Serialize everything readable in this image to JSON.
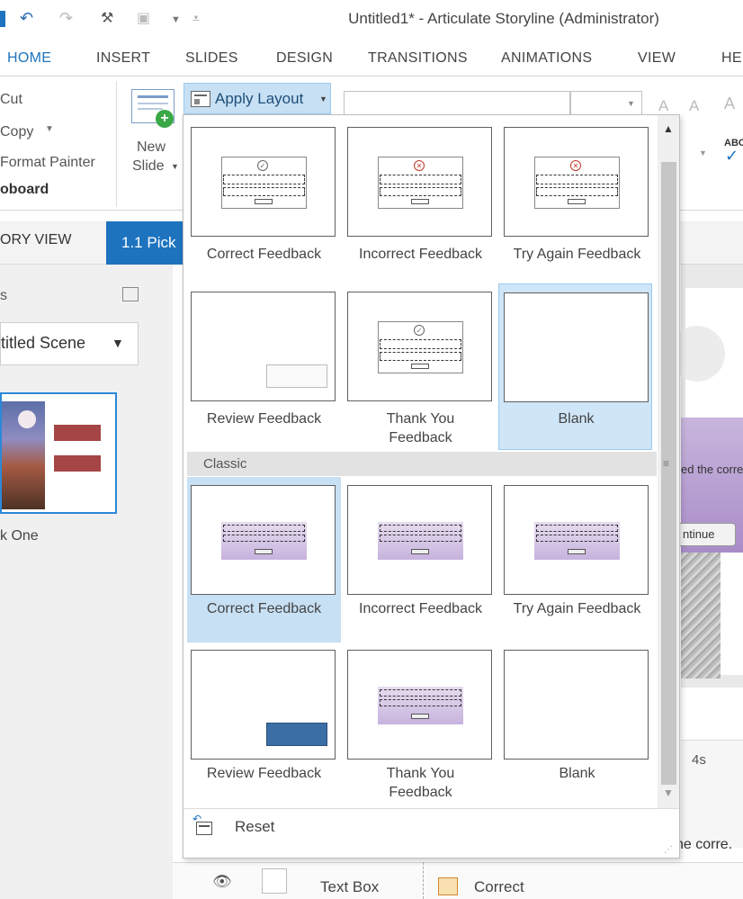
{
  "titlebar": {
    "title": "Untitled1* -  Articulate Storyline (Administrator)"
  },
  "tabs": [
    "HOME",
    "INSERT",
    "SLIDES",
    "DESIGN",
    "TRANSITIONS",
    "ANIMATIONS",
    "VIEW",
    "HE"
  ],
  "clipboard": {
    "cut": "Cut",
    "copy": "Copy",
    "format_painter": "Format Painter",
    "group": "oboard"
  },
  "new_slide": {
    "line1": "New",
    "line2": "Slide"
  },
  "apply_layout": {
    "label": "Apply Layout"
  },
  "story": {
    "view_label": "ORY VIEW",
    "slide_tab": "1.1 Pick",
    "scene": "titled Scene",
    "thumb_label": "k One"
  },
  "gallery": {
    "row1": [
      "Correct Feedback",
      "Incorrect Feedback",
      "Try Again Feedback"
    ],
    "row2": [
      "Review Feedback",
      "Thank You Feedback",
      "Blank"
    ],
    "classic_header": "Classic",
    "row3": [
      "Correct Feedback",
      "Incorrect Feedback",
      "Try Again Feedback"
    ],
    "row4": [
      "Review Feedback",
      "Thank You Feedback",
      "Blank"
    ],
    "reset": "Reset"
  },
  "canvas": {
    "text": "ed the corre",
    "continue": "ntinue",
    "time": "4s",
    "bottom_text": "he corre."
  },
  "bottombar": {
    "textbox": "Text Box",
    "correct": "Correct"
  },
  "colors": {
    "accent": "#1e73be",
    "selected": "#c7e0f4"
  }
}
